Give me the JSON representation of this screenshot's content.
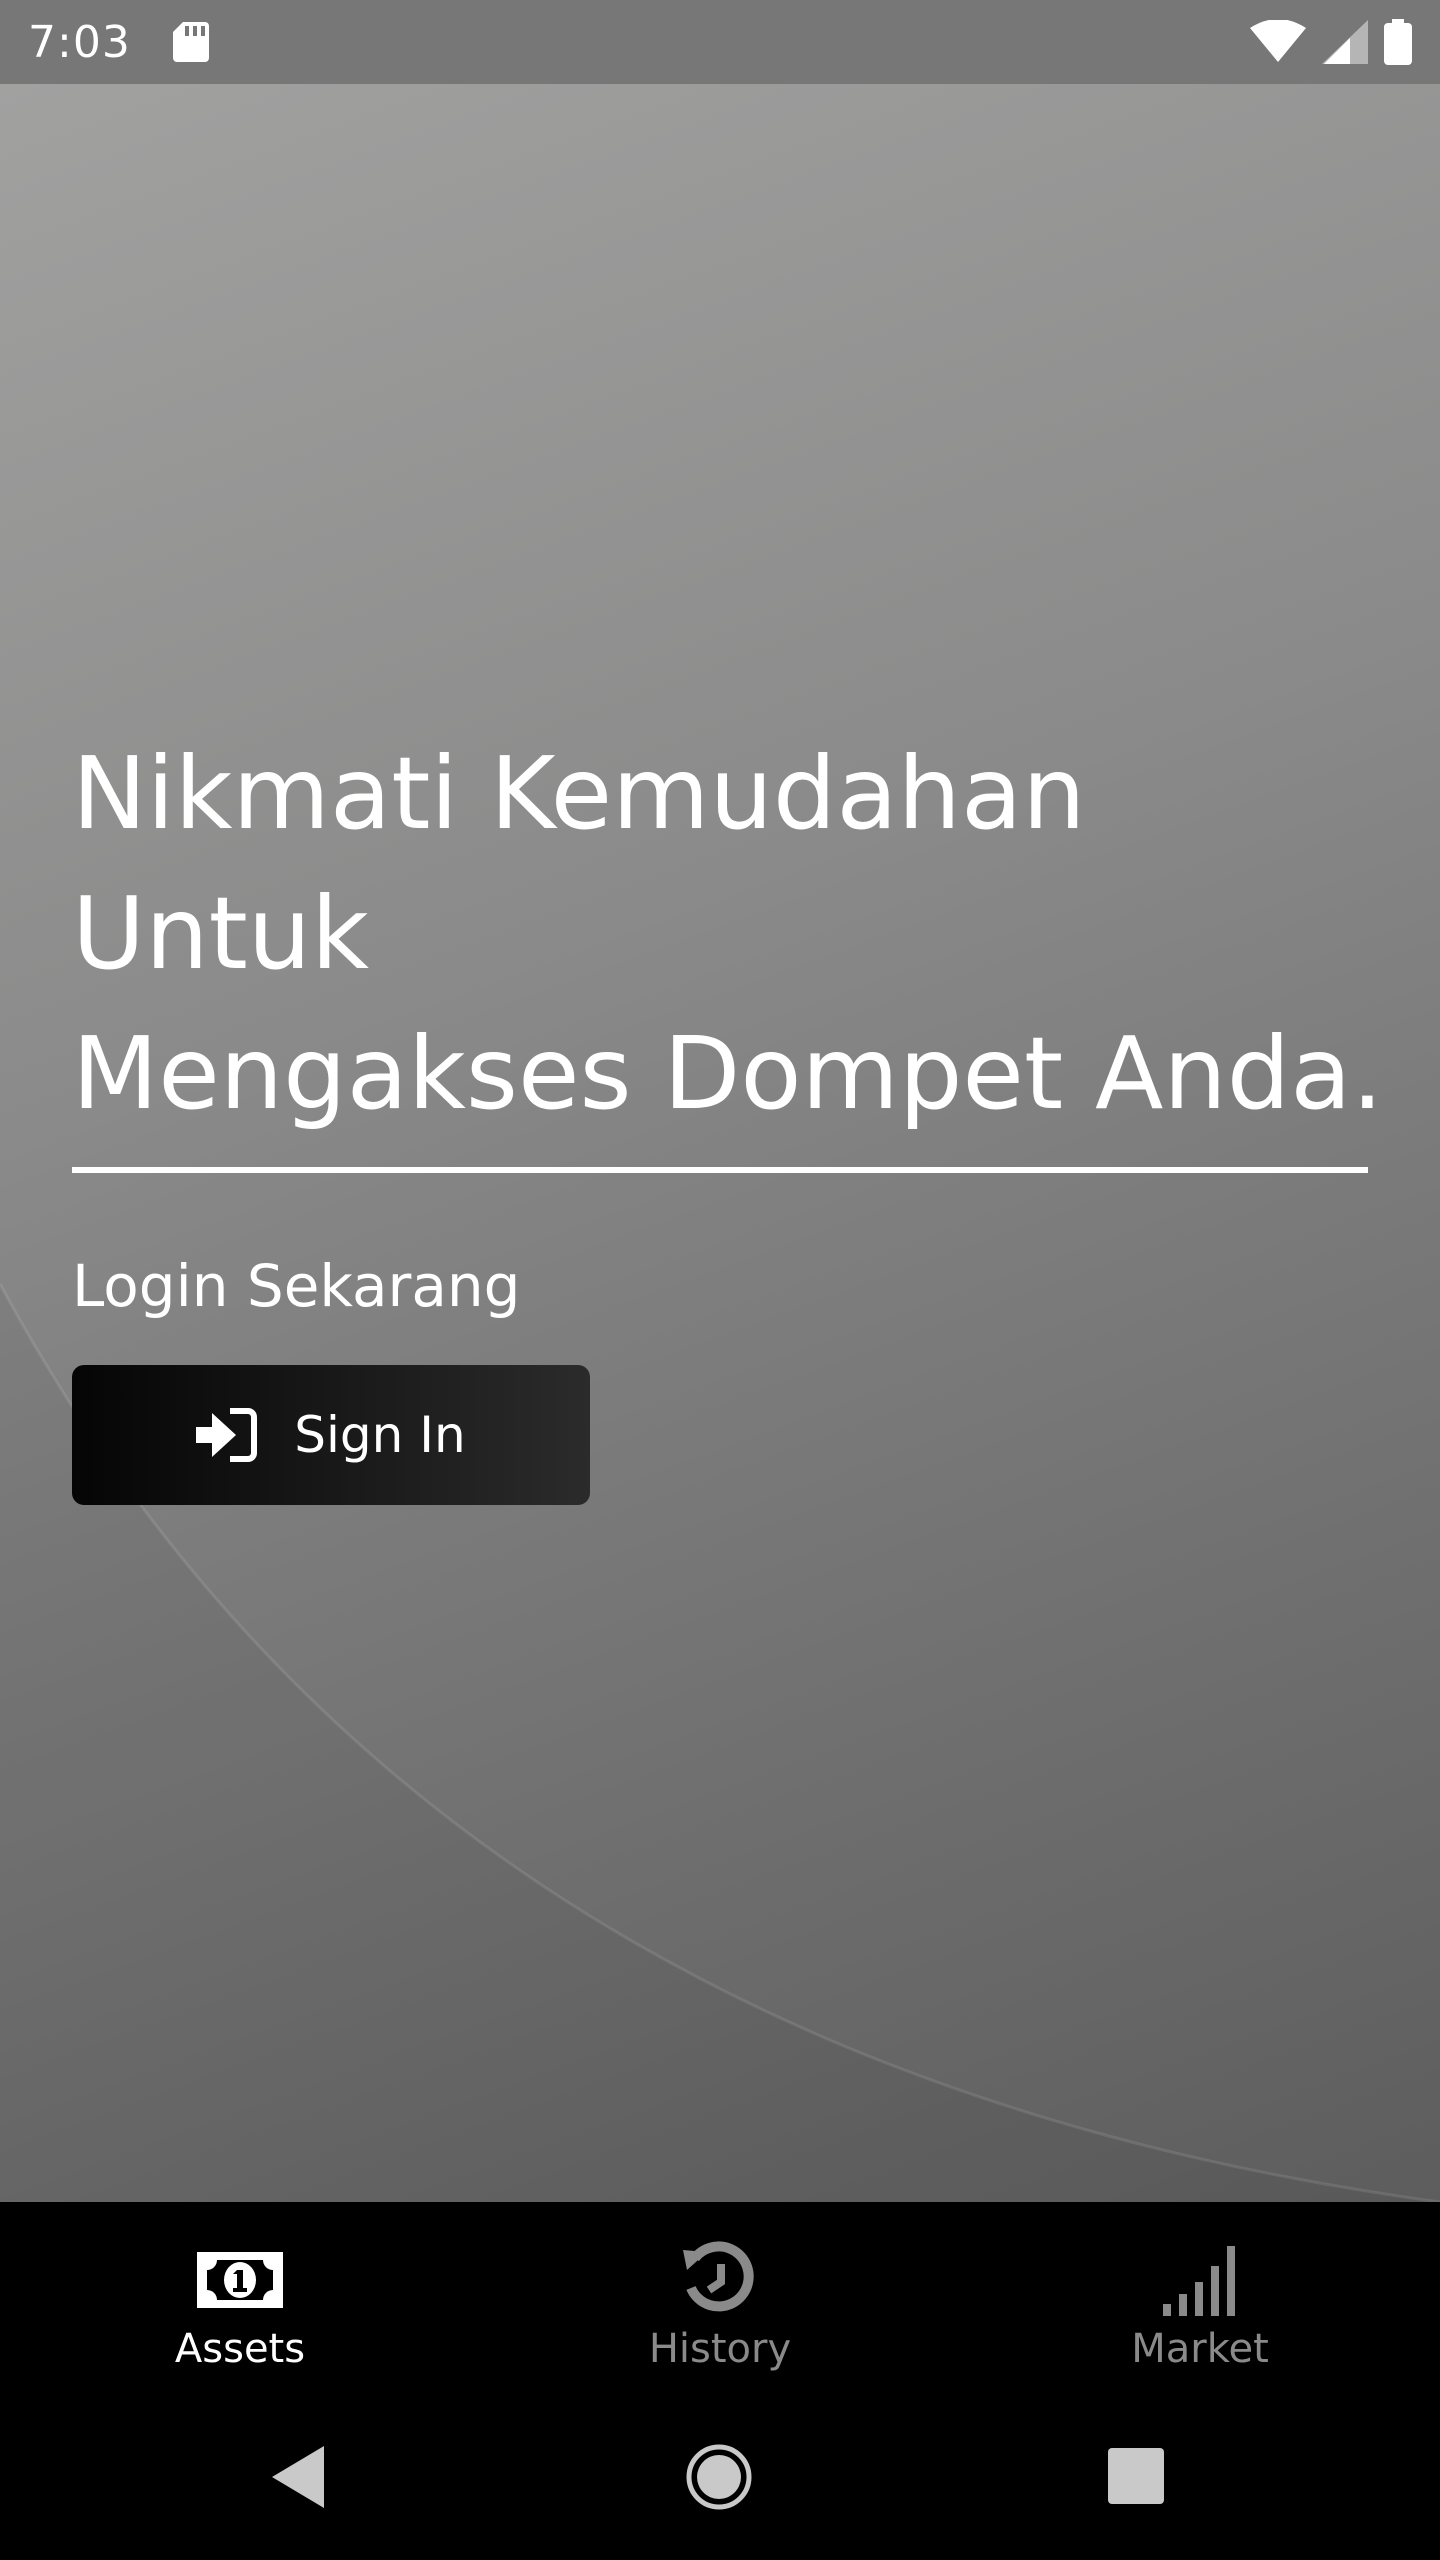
{
  "status_bar": {
    "time": "7:03",
    "icons": [
      "sd-card-icon",
      "wifi-icon",
      "cellular-signal-icon",
      "battery-icon"
    ]
  },
  "hero": {
    "headline_lines": [
      "Nikmati Kemudahan",
      "Untuk",
      "Mengakses Dompet Anda."
    ],
    "subtitle": "Login Sekarang"
  },
  "sign_in_button": {
    "label": "Sign In",
    "icon": "sign-in-icon"
  },
  "bottom_nav": {
    "items": [
      {
        "label": "Assets",
        "icon": "money-bill-icon",
        "active": true
      },
      {
        "label": "History",
        "icon": "history-icon",
        "active": false
      },
      {
        "label": "Market",
        "icon": "signal-bars-icon",
        "active": false
      }
    ]
  },
  "system_nav": {
    "buttons": [
      "back-icon",
      "home-icon",
      "recents-icon"
    ]
  },
  "colors": {
    "status_bar_bg": "#777777",
    "nav_bg": "#000000",
    "active_nav": "#ffffff",
    "inactive_nav": "#8a8a8a",
    "button_bg": "#0a0a0a",
    "text": "#ffffff"
  }
}
